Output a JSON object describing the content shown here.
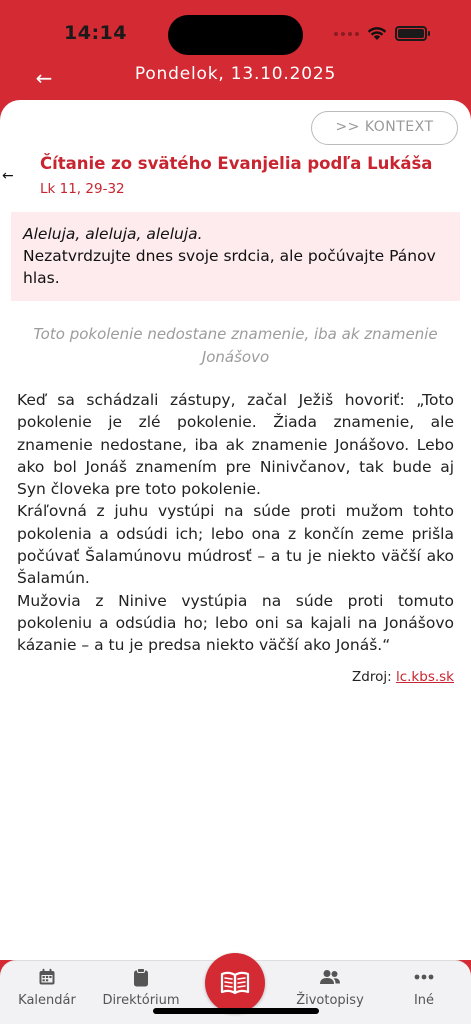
{
  "status": {
    "time": "14:14"
  },
  "header": {
    "title": "Pondelok, 13.10.2025"
  },
  "kontext_button": ">> KONTEXT",
  "reading": {
    "title": "Čítanie zo svätého Evanjelia podľa Lukáša",
    "reference": "Lk 11, 29-32"
  },
  "alleluia": {
    "acclamation": "Aleluja, aleluja, aleluja.",
    "verse": "Nezatvrdzujte dnes svoje srdcia, ale počúvajte Pánov hlas."
  },
  "motto": "Toto pokolenie nedostane znamenie, iba ak znamenie Jonášovo",
  "body": [
    "Keď sa schádzali zástupy, začal Ježiš hovoriť: „Toto pokolenie je zlé pokolenie. Žiada znamenie, ale znamenie nedostane, iba ak znamenie Jonášovo. Lebo ako bol Jonáš znamením pre Ninivčanov, tak bude aj Syn človeka pre toto pokolenie.",
    "Kráľovná z juhu vystúpi na súde proti mužom tohto pokolenia a odsúdi ich; lebo ona z končín zeme prišla počúvať Šalamúnovu múdrosť – a tu je niekto väčší ako Šalamún.",
    "Mužovia z Ninive vystúpia na súde proti tomuto pokoleniu a odsúdia ho; lebo oni sa kajali na Jonášovo kázanie – a tu je predsa niekto väčší ako Jonáš.“"
  ],
  "source": {
    "label": "Zdroj:",
    "link": "lc.kbs.sk"
  },
  "tabs": [
    {
      "label": "Kalendár",
      "icon": "calendar-icon"
    },
    {
      "label": "Direktórium",
      "icon": "clipboard-icon"
    },
    {
      "label": "",
      "icon": "open-book-icon"
    },
    {
      "label": "Životopisy",
      "icon": "people-icon"
    },
    {
      "label": "Iné",
      "icon": "more-dots-icon"
    }
  ],
  "colors": {
    "brand": "#d42a33",
    "accent_text": "#c82530",
    "alleluia_bg": "#fdebee"
  }
}
